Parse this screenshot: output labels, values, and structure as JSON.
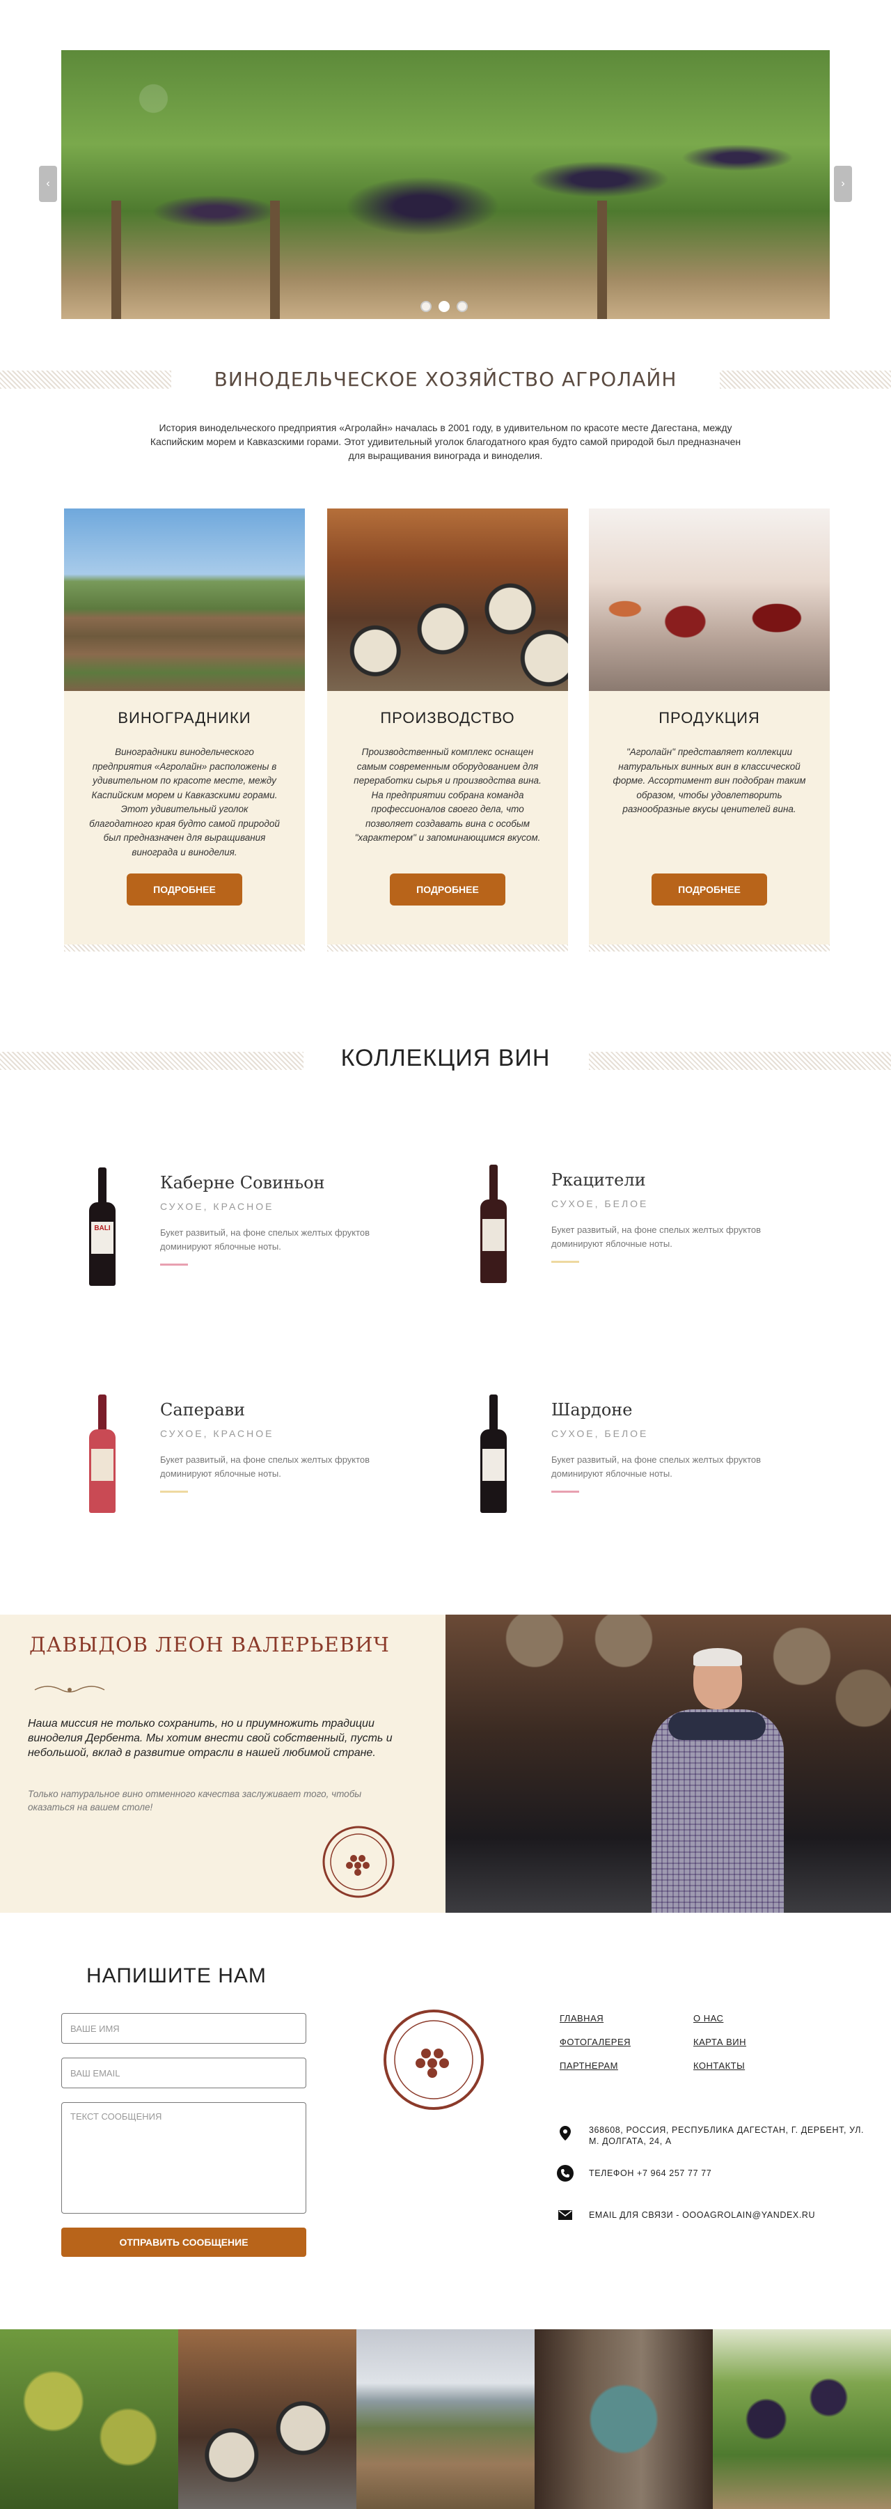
{
  "hero": {
    "prev_icon": "‹",
    "next_icon": "›",
    "slide_count": 3,
    "active_slide": 1
  },
  "about": {
    "title": "ВИНОДЕЛЬЧЕСКОЕ ХОЗЯЙСТВО АГРОЛАЙН",
    "text": "История винодельческого предприятия «Агролайн» началась в 2001 году, в удивительном по красоте месте Дагестана, между Каспийским морем и Кавказскими горами. Этот удивительный уголок благодатного края будто самой природой был предназначен для выращивания винограда и виноделия."
  },
  "cards": [
    {
      "title": "ВИНОГРАДНИКИ",
      "text": "Виноградники винодельческого предприятия «Агролайн» расположены в удивительном по красоте месте, между Каспийским морем и Кавказскими горами. Этот удивительный уголок благодатного края будто самой природой был предназначен для выращивания винограда и виноделия.",
      "button": "ПОДРОБНЕЕ"
    },
    {
      "title": "ПРОИЗВОДСТВО",
      "text": "Производственный комплекс оснащен самым современным оборудованием для переработки сырья и производства вина. На предприятии собрана команда профессионалов своего дела, что позволяет создавать вина с особым \"характером\" и запоминающимся вкусом.",
      "button": "ПОДРОБНЕЕ"
    },
    {
      "title": "ПРОДУКЦИЯ",
      "text": "\"Агролайн\" представляет коллекции натуральных винных вин в классической форме. Ассортимент вин подобран таким образом, чтобы удовлетворить разнообразные вкусы ценителей вина.",
      "button": "ПОДРОБНЕЕ"
    }
  ],
  "collection": {
    "title": "КОЛЛЕКЦИЯ ВИН",
    "wines": [
      {
        "name": "Каберне Совиньон",
        "type": "СУХОЕ, КРАСНОЕ",
        "desc": "Букет развитый, на фоне спелых желтых фруктов доминируют яблочные ноты.",
        "accent": "#e8a0b0",
        "bottle_label": "BALI"
      },
      {
        "name": "Ркацители",
        "type": "СУХОЕ, БЕЛОЕ",
        "desc": "Букет развитый, на фоне спелых желтых фруктов доминируют яблочные ноты.",
        "accent": "#eed9a0",
        "bottle_label": ""
      },
      {
        "name": "Саперави",
        "type": "СУХОЕ, КРАСНОЕ",
        "desc": "Букет развитый, на фоне спелых желтых фруктов доминируют яблочные ноты.",
        "accent": "#eed9a0",
        "bottle_label": ""
      },
      {
        "name": "Шардоне",
        "type": "СУХОЕ, БЕЛОЕ",
        "desc": "Букет развитый, на фоне спелых желтых фруктов доминируют яблочные ноты.",
        "accent": "#e8a0b0",
        "bottle_label": ""
      }
    ]
  },
  "founder": {
    "name": "ДАВЫДОВ ЛЕОН ВАЛЕРЬЕВИЧ",
    "mission": "Наша миссия не только сохранить, но и приумножить традиции виноделия Дербента. Мы хотим внести свой собственный, пусть и небольшой, вклад в развитие отрасли в нашей любимой стране.",
    "quote": "Только натуральное вино отменного качества заслуживает того, чтобы оказаться на вашем столе!"
  },
  "contact": {
    "title": "НАПИШИТЕ НАМ",
    "name_placeholder": "ВАШЕ ИМЯ",
    "email_placeholder": "ВАШ EMAIL",
    "message_placeholder": "ТЕКСТ СООБЩЕНИЯ",
    "submit": "ОТПРАВИТЬ СООБЩЕНИЕ"
  },
  "footer_nav": {
    "home": "ГЛАВНАЯ",
    "about": "О НАС",
    "gallery": "ФОТОГАЛЕРЕЯ",
    "wine_map": "КАРТА ВИН",
    "partners": "ПАРТНЕРАМ",
    "contacts": "КОНТАКТЫ"
  },
  "info": {
    "address": "368608, РОССИЯ, РЕСПУБЛИКА ДАГЕСТАН, Г. ДЕРБЕНТ, УЛ. М. ДОЛГАТА, 24, А",
    "phone": "ТЕЛЕФОН +7 964 257 77 77",
    "email": "EMAIL ДЛЯ СВЯЗИ - OOOAGROLAIN@YANDEX.RU"
  },
  "colors": {
    "accent": "#b8641a",
    "cream": "#f8f1e1",
    "founder_name": "#8b3a2a"
  }
}
